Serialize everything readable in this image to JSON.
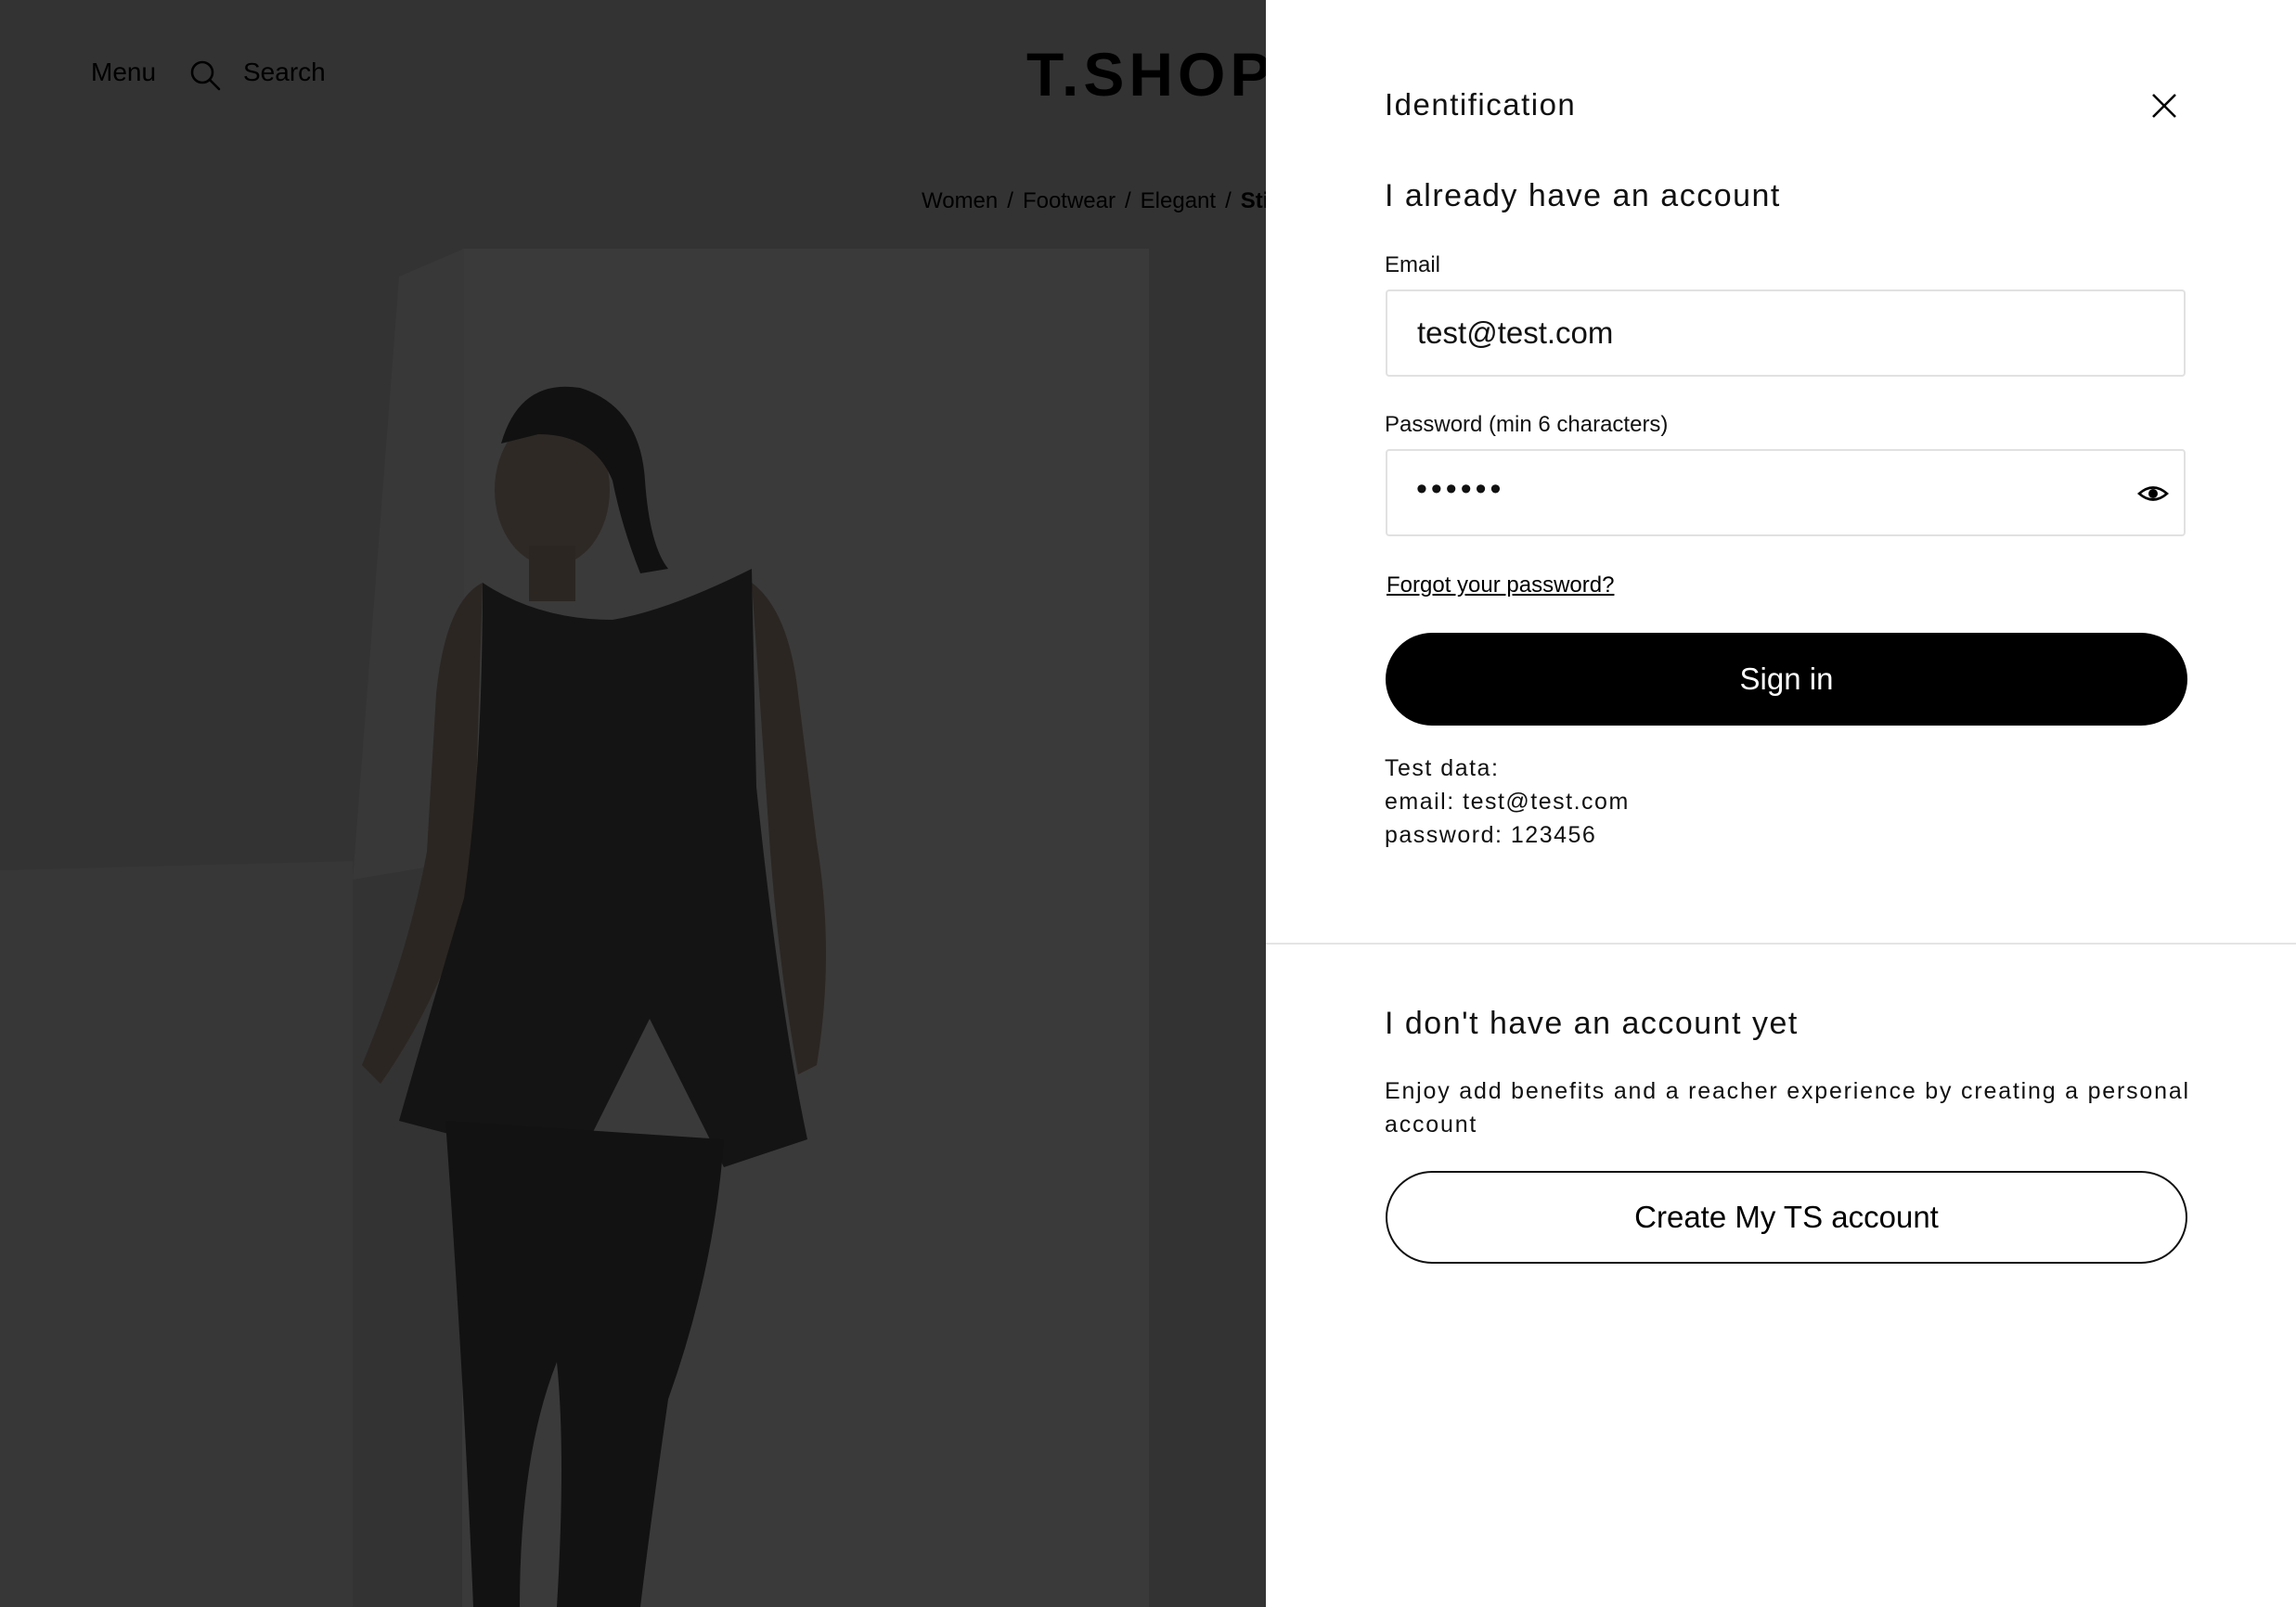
{
  "header": {
    "menu_label": "Menu",
    "search_label": "Search",
    "logo_text": "T.SHOP",
    "search_icon": "search-icon"
  },
  "breadcrumb": {
    "items": [
      "Women",
      "Footwear",
      "Elegant",
      "Sti"
    ],
    "separator": "/"
  },
  "panel": {
    "title": "Identification",
    "close_icon": "close-icon",
    "login": {
      "heading": "I already have an account",
      "email_label": "Email",
      "email_value": "test@test.com",
      "password_label": "Password (min 6 characters)",
      "password_masked": "••••••",
      "password_toggle_icon": "eye-icon",
      "forgot_link": "Forgot your password?",
      "signin_button": "Sign in",
      "test_data": {
        "title": "Test data:",
        "email_line": "email: test@test.com",
        "password_line": "password: 123456"
      }
    },
    "register": {
      "heading": "I don't have an account yet",
      "description": "Enjoy add benefits and a reacher experience by creating a personal account",
      "create_button": "Create My TS account"
    }
  },
  "colors": {
    "overlay_background": "#333333",
    "panel_background": "#ffffff",
    "primary_button": "#000000",
    "divider": "#e4e4e4"
  }
}
